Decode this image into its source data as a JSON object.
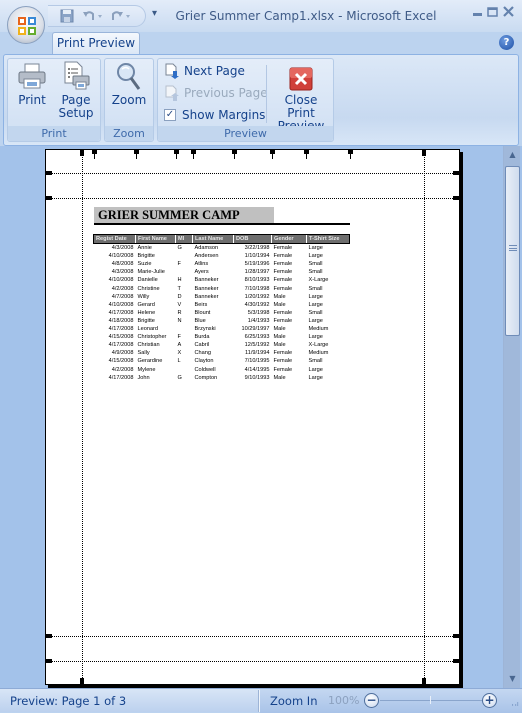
{
  "window": {
    "title": "Grier Summer Camp1.xlsx - Microsoft Excel",
    "controls": [
      "minimize",
      "maximize",
      "close"
    ]
  },
  "quick_access": {
    "items": [
      "save-icon",
      "undo-icon",
      "redo-icon"
    ],
    "customize": "▾"
  },
  "ribbon": {
    "active_tab": "Print Preview",
    "help": "?",
    "groups": [
      {
        "label": "Print",
        "buttons": [
          {
            "label_line1": "Print",
            "label_line2": ""
          },
          {
            "label_line1": "Page",
            "label_line2": "Setup"
          }
        ]
      },
      {
        "label": "Zoom",
        "buttons": [
          {
            "label_line1": "Zoom"
          }
        ]
      },
      {
        "label": "Preview",
        "next_page": "Next Page",
        "previous_page": "Previous Page",
        "show_margins": "Show Margins",
        "show_margins_checked": true,
        "close_line1": "Close Print",
        "close_line2": "Preview"
      }
    ]
  },
  "sheet": {
    "title": "GRIER SUMMER CAMP",
    "columns": [
      "Regist Date",
      "First Name",
      "MI",
      "Last Name",
      "DOB",
      "Gender",
      "T-Shirt Size"
    ],
    "rows": [
      [
        "4/3/2008",
        "Annie",
        "G",
        "Adamson",
        "3/22/1998",
        "Female",
        "Large"
      ],
      [
        "4/10/2008",
        "Brigitte",
        "",
        "Andersen",
        "1/10/1994",
        "Female",
        "Large"
      ],
      [
        "4/8/2008",
        "Suzie",
        "F",
        "Atlins",
        "5/19/1996",
        "Female",
        "Small"
      ],
      [
        "4/3/2008",
        "Marie-Julie",
        "",
        "Ayers",
        "1/28/1997",
        "Female",
        "Small"
      ],
      [
        "4/10/2008",
        "Danielle",
        "H",
        "Banneker",
        "8/10/1993",
        "Female",
        "X-Large"
      ],
      [
        "4/2/2008",
        "Christine",
        "T",
        "Banneker",
        "7/10/1998",
        "Female",
        "Small"
      ],
      [
        "4/7/2008",
        "Willy",
        "D",
        "Banneker",
        "1/20/1992",
        "Male",
        "Large"
      ],
      [
        "4/10/2008",
        "Gerard",
        "V",
        "Beirs",
        "4/30/1992",
        "Male",
        "Large"
      ],
      [
        "4/17/2008",
        "Helene",
        "R",
        "Blount",
        "5/3/1998",
        "Female",
        "Small"
      ],
      [
        "4/18/2008",
        "Brigitte",
        "N",
        "Blue",
        "1/4/1993",
        "Female",
        "Large"
      ],
      [
        "4/17/2008",
        "Leonard",
        "",
        "Brzynski",
        "10/29/1997",
        "Male",
        "Medium"
      ],
      [
        "4/15/2008",
        "Christopher",
        "F",
        "Burda",
        "6/25/1993",
        "Male",
        "Large"
      ],
      [
        "4/17/2008",
        "Christian",
        "A",
        "Cabril",
        "12/5/1992",
        "Male",
        "X-Large"
      ],
      [
        "4/9/2008",
        "Sally",
        "X",
        "Chang",
        "11/9/1994",
        "Female",
        "Medium"
      ],
      [
        "4/15/2008",
        "Gerardine",
        "L",
        "Clayton",
        "7/10/1995",
        "Female",
        "Small"
      ],
      [
        "4/2/2008",
        "Mylene",
        "",
        "Coldwell",
        "4/14/1995",
        "Female",
        "Large"
      ],
      [
        "4/17/2008",
        "John",
        "G",
        "Compton",
        "9/10/1993",
        "Male",
        "Large"
      ]
    ]
  },
  "status": {
    "page_info": "Preview: Page 1 of 3",
    "zoom_in": "Zoom In",
    "zoom_level": "100%",
    "zoom_minus": "−",
    "zoom_plus": "+"
  },
  "colors": {
    "accent_text": "#15428b",
    "workspace": "#a3c2ea",
    "header_fill": "#6e6e6e",
    "title_fill": "#c0c0c0",
    "close_button": "#d0403a"
  }
}
